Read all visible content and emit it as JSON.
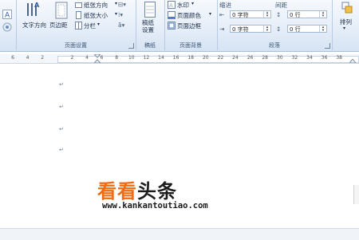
{
  "ribbon": {
    "page_setup": {
      "group_label": "页面设置",
      "text_direction": "文字方向",
      "margins": "页边距",
      "orientation": "纸张方向",
      "size": "纸张大小",
      "columns": "分栏"
    },
    "manuscript": {
      "group_label": "稿纸",
      "button": "稿纸\n设置"
    },
    "page_background": {
      "group_label": "页面背景",
      "watermark": "水印",
      "page_color": "页面颜色",
      "page_borders": "页面边框"
    },
    "paragraph": {
      "group_label": "段落",
      "indent_label": "缩进",
      "spacing_label": "间距",
      "indent_left": "0 字符",
      "indent_right": "0 字符",
      "spacing_before": "0 行",
      "spacing_after": "0 行"
    },
    "arrange": {
      "button": "排列"
    }
  },
  "ruler": {
    "numbers": [
      "6",
      "4",
      "2",
      "",
      "2",
      "4",
      "6",
      "8",
      "10",
      "12",
      "14",
      "16",
      "18",
      "20",
      "22",
      "24",
      "26",
      "28",
      "30",
      "32",
      "34",
      "36",
      "38"
    ]
  },
  "document": {
    "paragraph_mark": "↵"
  },
  "watermark": {
    "title_a": "看看",
    "title_b": "头条",
    "url": "www.kankantoutiao.com"
  },
  "colors": {
    "ribbon_bg": "#dfe9f5",
    "watermark_orange": "#f06a12"
  }
}
